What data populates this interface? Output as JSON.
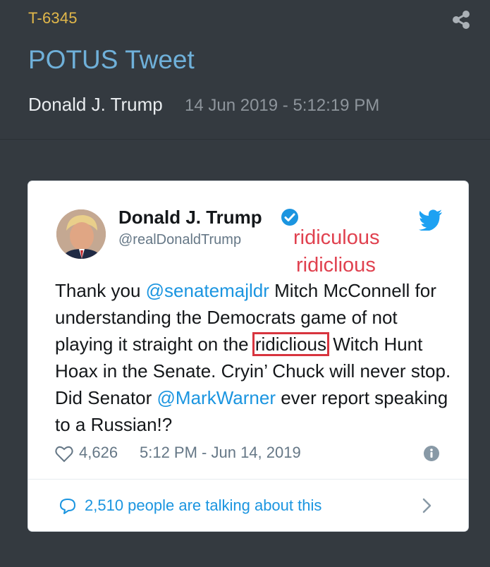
{
  "header": {
    "tag": "T-6345",
    "title": "POTUS Tweet",
    "author": "Donald J. Trump",
    "timestamp": "14 Jun 2019 - 5:12:19 PM"
  },
  "tweet": {
    "display_name": "Donald J. Trump",
    "handle": "@realDonaldTrump",
    "annotations": [
      "ridiculous",
      "ridiclious"
    ],
    "body": {
      "part1": "Thank you ",
      "mention1": "@senatemajldr",
      "part2": " Mitch McConnell for understanding the Democrats game of not playing it straight on the ",
      "highlighted": "ridiclious",
      "part3": " Witch Hunt Hoax in the Senate. Cryin’ Chuck will never stop. Did Senator ",
      "mention2": "@MarkWarner",
      "part4": " ever report speaking to a Russian!?"
    },
    "likes": "4,626",
    "date": "5:12 PM - Jun 14, 2019",
    "talking": "2,510 people are talking about this"
  },
  "colors": {
    "background": "#343a40",
    "tag": "#e2b84a",
    "title": "#6fb0d9",
    "link": "#1b95e0",
    "annotation": "#e0414f"
  },
  "icons": [
    "share-icon",
    "verified-icon",
    "twitter-bird-icon",
    "heart-icon",
    "info-icon",
    "speech-bubble-icon",
    "chevron-right-icon"
  ]
}
